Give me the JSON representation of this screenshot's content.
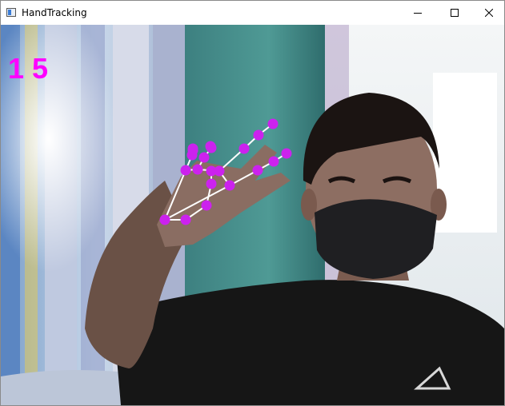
{
  "window": {
    "title": "HandTracking",
    "icon": "opencv-window-icon"
  },
  "controls": {
    "minimize": "minimize-icon",
    "maximize": "maximize-icon",
    "close": "close-icon"
  },
  "overlay": {
    "fps": "15",
    "fps_color": "#ff00ff",
    "landmark_color": "#cc22ee",
    "connection_color": "#ffffff"
  }
}
